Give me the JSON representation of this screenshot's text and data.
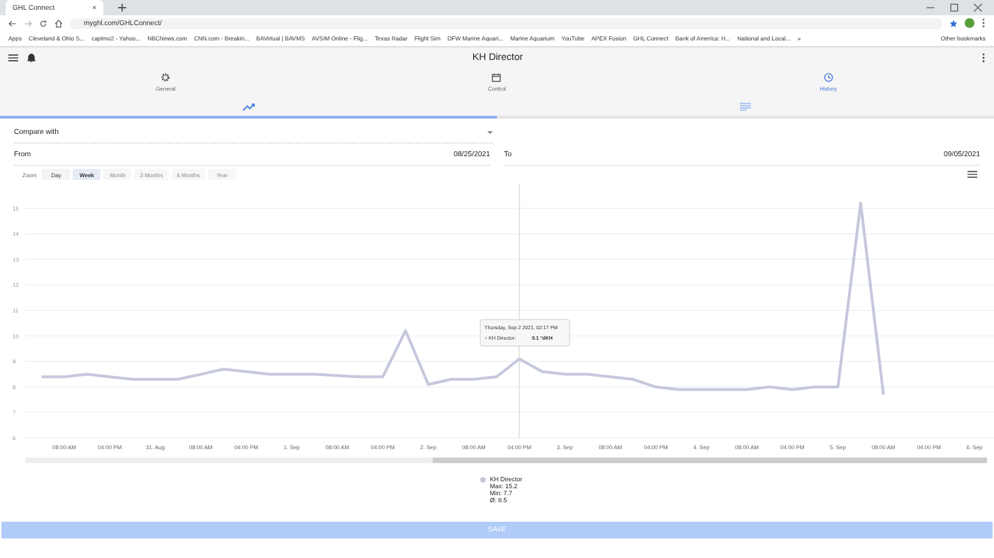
{
  "browser": {
    "tab_title": "GHL Connect",
    "tab_close": "×",
    "url": "myghl.com/GHLConnect/",
    "bookmarks": [
      "Apps",
      "Cleveland & Ohio S...",
      "captmo2 - Yahoo...",
      "NBCNews.com",
      "CNN.com - Breakin...",
      "BAVirtual | BAVMS",
      "AVSIM Online - Flig...",
      "Texas Radar",
      "Flight Sim",
      "DFW Marine Aquari...",
      "Marine Aquarium",
      "YouTube",
      "APEX Fusion",
      "GHL Connect",
      "Bank of America: H...",
      "National and Local..."
    ],
    "overflow": "»",
    "other_bookmarks": "Other bookmarks"
  },
  "app_bar": {
    "title": "KH Director"
  },
  "tabs": [
    {
      "label": "General",
      "selected": false
    },
    {
      "label": "Control",
      "selected": false
    },
    {
      "label": "History",
      "selected": true
    }
  ],
  "view_tabs": [
    {
      "selected": true
    },
    {
      "selected": false
    }
  ],
  "compare": {
    "placeholder": "Compare with"
  },
  "range": {
    "from_label": "From",
    "from": "08/25/2021",
    "to_label": "To",
    "to": "09/05/2021"
  },
  "zoom": {
    "label": "Zoom",
    "buttons": [
      {
        "label": "Day",
        "selected": false,
        "disabled": false
      },
      {
        "label": "Week",
        "selected": true,
        "disabled": false
      },
      {
        "label": "Month",
        "selected": false,
        "disabled": true
      },
      {
        "label": "3 Months",
        "selected": false,
        "disabled": true
      },
      {
        "label": "6 Months",
        "selected": false,
        "disabled": true
      },
      {
        "label": "Year",
        "selected": false,
        "disabled": true
      }
    ]
  },
  "chart": {
    "tooltip": {
      "date": "Thursday, Sep 2 2021, 02:17 PM",
      "series": "KH Director:",
      "value": "9.1 °dKH"
    },
    "chart_data": {
      "type": "line",
      "grid": true,
      "categories": [
        null,
        "08:00 AM",
        null,
        "04:00 PM",
        null,
        "31. Aug",
        null,
        "08:00 AM",
        null,
        "04:00 PM",
        null,
        "1. Sep",
        null,
        "08:00 AM",
        null,
        "04:00 PM",
        null,
        "2. Sep",
        null,
        "08:00 AM",
        null,
        "04:00 PM",
        null,
        "3. Sep",
        null,
        "08:00 AM",
        null,
        "04:00 PM",
        null,
        "4. Sep",
        null,
        "08:00 AM",
        null,
        "04:00 PM",
        null,
        "5. Sep",
        null,
        "08:00 AM",
        null,
        "04:00 PM",
        null,
        "6. Sep"
      ],
      "series": [
        {
          "name": "KH Director",
          "color": "#c5c8dc",
          "values": [
            8.4,
            8.4,
            8.5,
            8.4,
            8.3,
            8.3,
            8.3,
            8.5,
            8.7,
            8.6,
            8.5,
            8.5,
            8.5,
            8.45,
            8.4,
            8.4,
            10.2,
            8.1,
            8.3,
            8.3,
            8.4,
            9.1,
            8.6,
            8.5,
            8.5,
            8.4,
            8.3,
            8.0,
            7.9,
            7.9,
            7.9,
            7.9,
            8.0,
            7.9,
            8.0,
            8.0,
            15.2,
            7.7,
            null,
            null,
            null,
            null
          ]
        }
      ],
      "ylim": [
        6,
        16
      ],
      "yticks": [
        6,
        7,
        8,
        9,
        10,
        11,
        12,
        13,
        14,
        15
      ]
    }
  },
  "legend": {
    "max": "Max: 15.2",
    "min": "Min: 7.7",
    "avg": "Ø: 8.5"
  },
  "save_button": "SAVE"
}
